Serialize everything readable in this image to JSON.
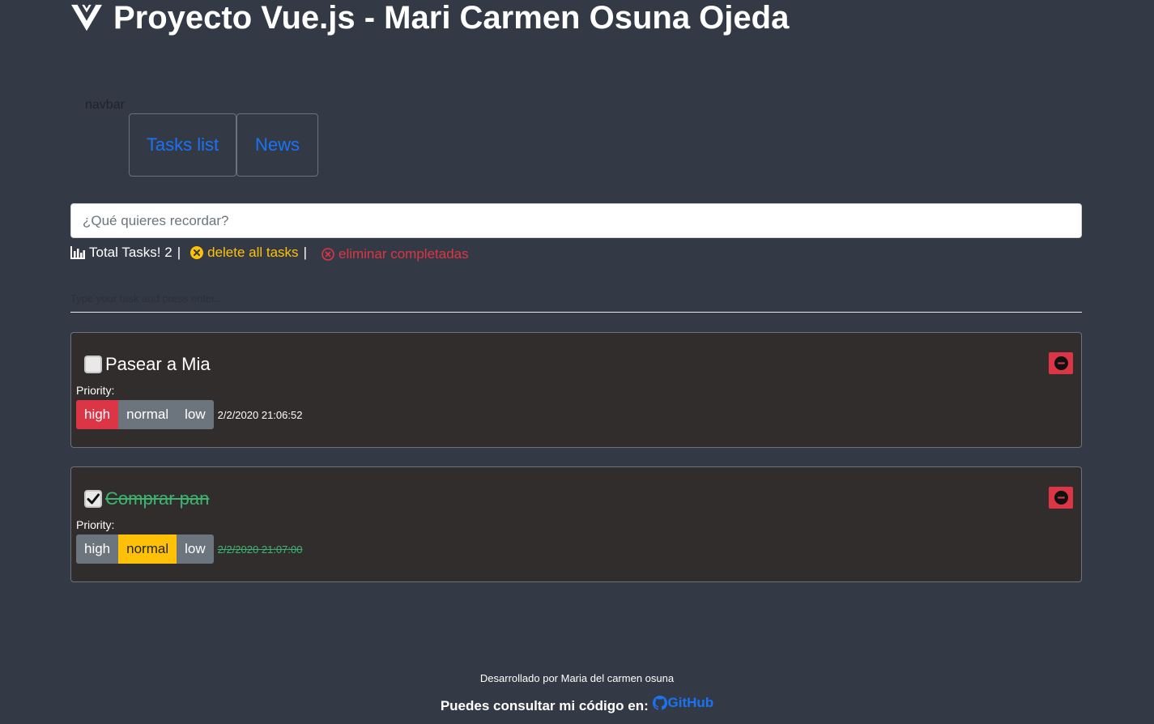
{
  "header": {
    "title": "Proyecto Vue.js - Mari Carmen Osuna Ojeda",
    "logo_icon": "vue-logo-icon"
  },
  "navbar": {
    "label": "navbar",
    "tabs": [
      {
        "label": "Tasks list"
      },
      {
        "label": "News"
      }
    ],
    "link_color": "#1a73f5"
  },
  "main_input": {
    "placeholder": "¿Qué quieres recordar?",
    "value": ""
  },
  "stats": {
    "icon": "bar-chart-icon",
    "total_label": "Total Tasks! 2",
    "separator": "|",
    "delete_all": "delete all tasks",
    "delete_completed": "eliminar completadas"
  },
  "task_input": {
    "placeholder": "Type your task and press enter...",
    "value": ""
  },
  "tasks": [
    {
      "text": "Pasear a Mia",
      "completed": false,
      "priority_label": "Priority:",
      "priorities": [
        "high",
        "normal",
        "low"
      ],
      "active_priority": "high",
      "date": "2/2/2020 21:06:52"
    },
    {
      "text": "Comprar pan",
      "completed": true,
      "priority_label": "Priority:",
      "priorities": [
        "high",
        "normal",
        "low"
      ],
      "active_priority": "normal",
      "date": "2/2/2020 21:07:00"
    }
  ],
  "footer": {
    "developed_by": "Desarrollado por Maria del carmen osuna",
    "code_text": "Puedes consultar mi código en:",
    "github_label": "GitHub"
  },
  "colors": {
    "background": "#343a45",
    "card": "#322d2d",
    "danger": "#dc3545",
    "warning": "#ffc107",
    "secondary": "#6c757d",
    "completed": "#3eb370"
  }
}
